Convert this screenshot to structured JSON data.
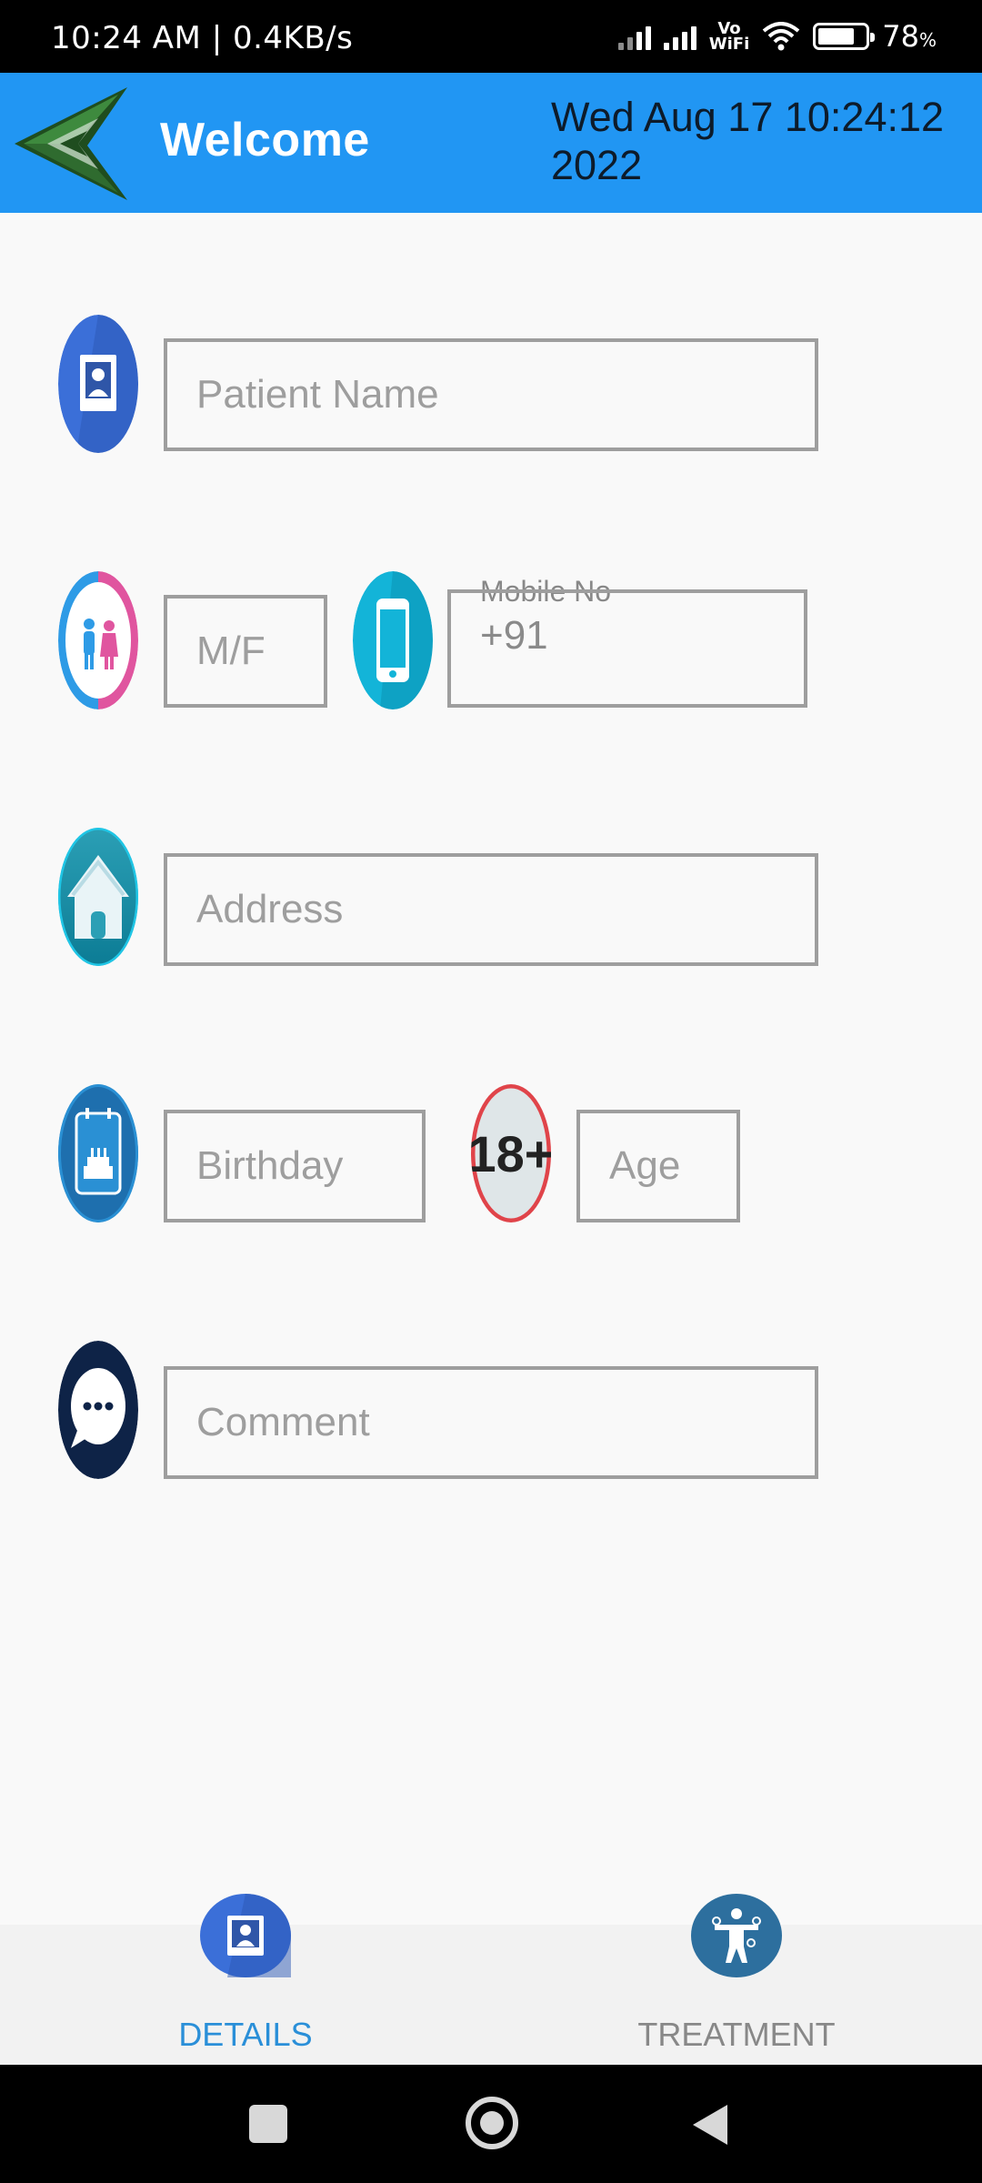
{
  "status_bar": {
    "time_speed": "10:24 AM | 0.4KB/s",
    "vowifi_top": "Vo",
    "vowifi_bottom": "WiFi",
    "battery": "78",
    "battery_unit": "%",
    "battery_level": 0.78
  },
  "app_bar": {
    "title": "Welcome",
    "datetime": "Wed Aug 17 10:24:12 2022",
    "color": "#2196f3"
  },
  "form": {
    "patient_name_placeholder": "Patient Name",
    "gender_placeholder": "M/F",
    "mobile_label": "Mobile No",
    "mobile_value": "+91",
    "address_placeholder": "Address",
    "birthday_placeholder": "Birthday",
    "age_badge": "18+",
    "age_placeholder": "Age",
    "comment_placeholder": "Comment"
  },
  "bottom_nav": {
    "items": [
      {
        "label": "DETAILS",
        "icon": "patient-card-icon",
        "active": true,
        "color": "#2a8fd8"
      },
      {
        "label": "TREATMENT",
        "icon": "body-figure-icon",
        "active": false,
        "color": "#888888"
      }
    ]
  },
  "system_nav": {
    "icons": [
      "recents-square-icon",
      "home-circle-icon",
      "back-triangle-icon"
    ]
  }
}
